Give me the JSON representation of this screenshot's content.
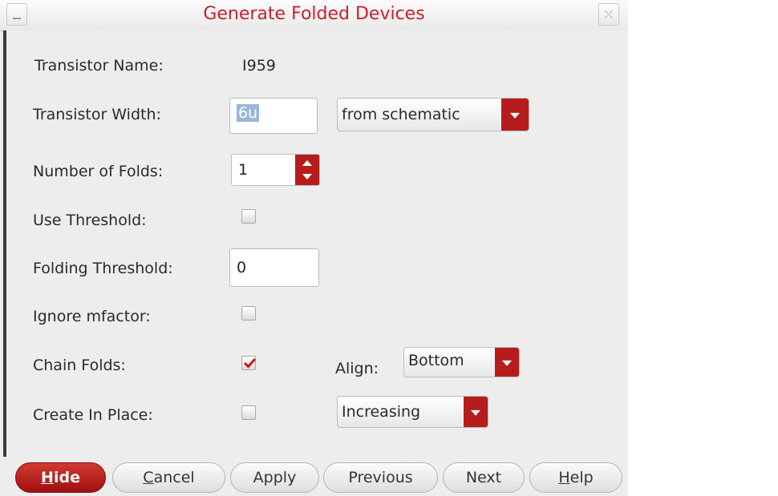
{
  "window": {
    "title": "Generate Folded Devices",
    "minimize_icon": "minimize-icon",
    "close_icon": "close-icon",
    "close_glyph": "⛌"
  },
  "form": {
    "transistor_name": {
      "label": "Transistor Name:",
      "value": "I959"
    },
    "transistor_width": {
      "label": "Transistor Width:",
      "value": "6u",
      "source_selected": "from schematic"
    },
    "number_of_folds": {
      "label": "Number of Folds:",
      "value": "1"
    },
    "use_threshold": {
      "label": "Use Threshold:",
      "checked": false
    },
    "folding_threshold": {
      "label": "Folding Threshold:",
      "value": "0"
    },
    "ignore_mfactor": {
      "label": "Ignore mfactor:",
      "checked": false
    },
    "chain_folds": {
      "label": "Chain Folds:",
      "checked": true
    },
    "align": {
      "label": "Align:",
      "selected": "Bottom"
    },
    "create_in_place": {
      "label": "Create In Place:",
      "checked": false
    },
    "order": {
      "selected": "Increasing"
    }
  },
  "buttons": {
    "hide": {
      "mnemonic": "H",
      "rest": "ide"
    },
    "cancel": {
      "mnemonic": "C",
      "rest": "ancel"
    },
    "apply": {
      "label": "Apply"
    },
    "previous": {
      "label": "Previous"
    },
    "next": {
      "label": "Next"
    },
    "help": {
      "mnemonic": "H",
      "rest": "elp"
    }
  },
  "colors": {
    "accent_red": "#b71c1c",
    "title_red": "#c8202b",
    "panel_bg": "#ededed"
  }
}
